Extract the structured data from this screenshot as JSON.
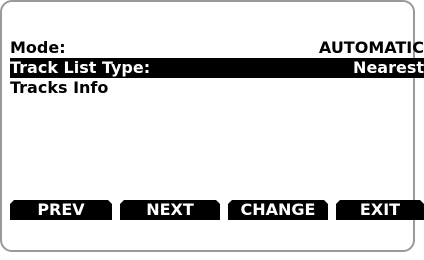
{
  "screen": {
    "mode_label": "Mode:",
    "mode_value": "AUTOMATIC",
    "track_list_type_label": "Track List Type:",
    "track_list_type_value": "Nearest",
    "tracks_info_label": "Tracks Info"
  },
  "softkeys": {
    "prev": "PREV",
    "next": "NEXT",
    "change": "CHANGE",
    "exit": "EXIT"
  }
}
